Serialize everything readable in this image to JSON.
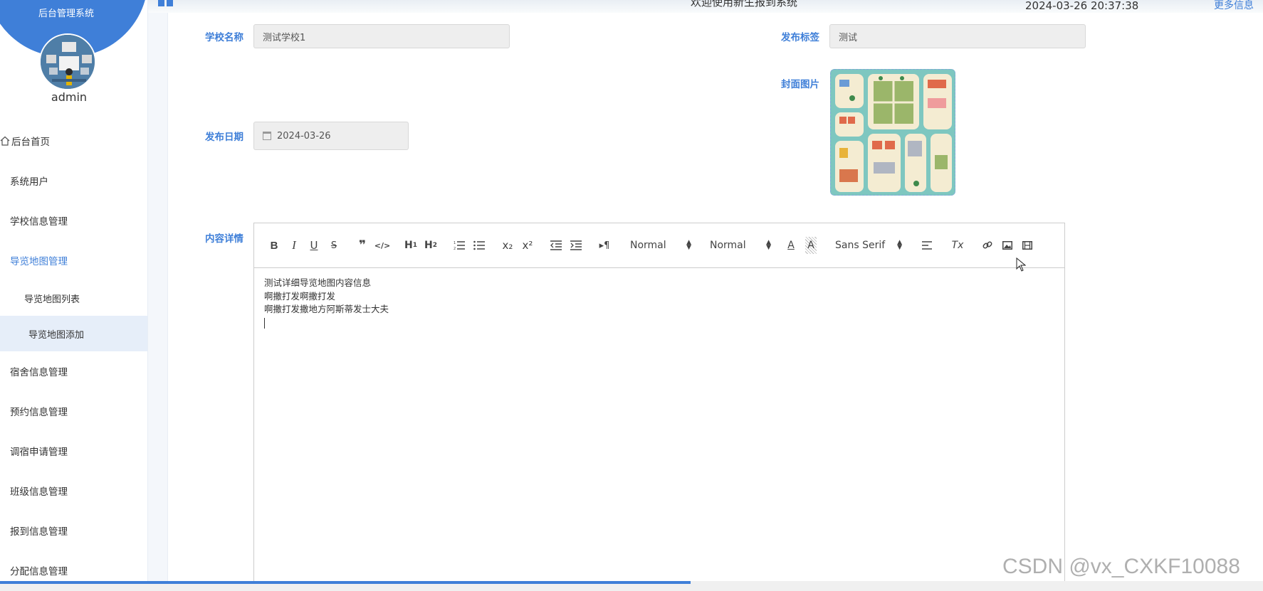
{
  "sidebar": {
    "brand_title": "后台管理系统",
    "username": "admin",
    "items": [
      {
        "label": "后台首页"
      },
      {
        "label": "系统用户"
      },
      {
        "label": "学校信息管理"
      },
      {
        "label": "导览地图管理"
      }
    ],
    "subitems": [
      {
        "label": "导览地图列表"
      },
      {
        "label": "导览地图添加"
      }
    ],
    "items_after": [
      {
        "label": "宿舍信息管理"
      },
      {
        "label": "预约信息管理"
      },
      {
        "label": "调宿申请管理"
      },
      {
        "label": "班级信息管理"
      },
      {
        "label": "报到信息管理"
      },
      {
        "label": "分配信息管理"
      }
    ],
    "accent_color": "#3f7fd8"
  },
  "header": {
    "welcome": "欢迎使用新生报到系统",
    "datetime": "2024-03-26 20:37:38",
    "more_info": "更多信息"
  },
  "form": {
    "school_name_label": "学校名称",
    "school_name_value": "测试学校1",
    "tag_label": "发布标签",
    "tag_value": "测试",
    "cover_label": "封面图片",
    "date_label": "发布日期",
    "date_value": "2024-03-26",
    "content_label": "内容详情"
  },
  "editor": {
    "toolbar": {
      "bold": "B",
      "italic": "I",
      "underline": "U",
      "strike": "S",
      "blockquote": "❞",
      "code": "</>",
      "h1": "H",
      "h1_sub": "1",
      "h2": "H",
      "h2_sub": "2",
      "ordered_list": "☰",
      "bullet_list": "☷",
      "subscript": "x₂",
      "superscript": "x²",
      "indent_dec": "⇤",
      "indent_inc": "⇥",
      "direction": "▸¶",
      "size_picker": "Normal",
      "header_picker": "Normal",
      "font_color": "A",
      "background": "A",
      "font_picker": "Sans Serif",
      "align": "≡",
      "clean": "Tx",
      "link": "🔗",
      "image": "▣",
      "video": "▤"
    },
    "content_lines": [
      "测试详细导览地图内容信息",
      "啊撒打发啊撒打发",
      "啊撒打发撒地方阿斯蒂发士大夫"
    ]
  },
  "watermark": "CSDN @vx_CXKF10088"
}
